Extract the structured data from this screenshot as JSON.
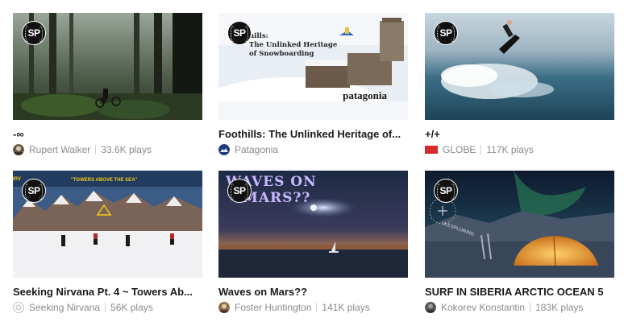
{
  "cards": [
    {
      "badge": "SP",
      "title": "-∞",
      "author": "Rupert Walker",
      "plays": "33.6K plays",
      "avatar_color": "#5a4a3a",
      "thumb_text": ""
    },
    {
      "badge": "SP",
      "title": "Foothills: The Unlinked Heritage of...",
      "author": "Patagonia",
      "plays": "",
      "avatar_color": "#2a4a8a",
      "thumb_text": "Foothills:\nThe Unlinked Heritage\nof Snowboarding",
      "thumb_text_line1": "hills:",
      "thumb_text_line2": "The Unlinked Heritage",
      "thumb_text_line3": "of Snowboarding",
      "brand": "patagonia"
    },
    {
      "badge": "SP",
      "title": "+/+",
      "author": "GLOBE",
      "plays": "117K plays",
      "avatar_color": "#d22"
    },
    {
      "badge": "SP",
      "title": "Seeking Nirvana Pt. 4 ~ Towers Ab...",
      "author": "Seeking Nirvana",
      "plays": "56K plays",
      "avatar_color": "#bbbbbb",
      "thumb_text": "\"TOWERS ABOVE THE SEA\"",
      "corner_text": "IRV"
    },
    {
      "badge": "SP",
      "title": "Waves on Mars??",
      "author": "Foster Huntington",
      "plays": "141K plays",
      "avatar_color": "#7a5a3a",
      "thumb_text_line1": "WAVES ON",
      "thumb_text_line2": "MARS??"
    },
    {
      "badge": "SP",
      "title": "SURF IN SIBERIA ARCTIC OCEAN 5",
      "author": "Kokorev Konstantin",
      "plays": "183K plays",
      "avatar_color": "#555555",
      "thumb_text": "IA EXPLORING"
    }
  ]
}
